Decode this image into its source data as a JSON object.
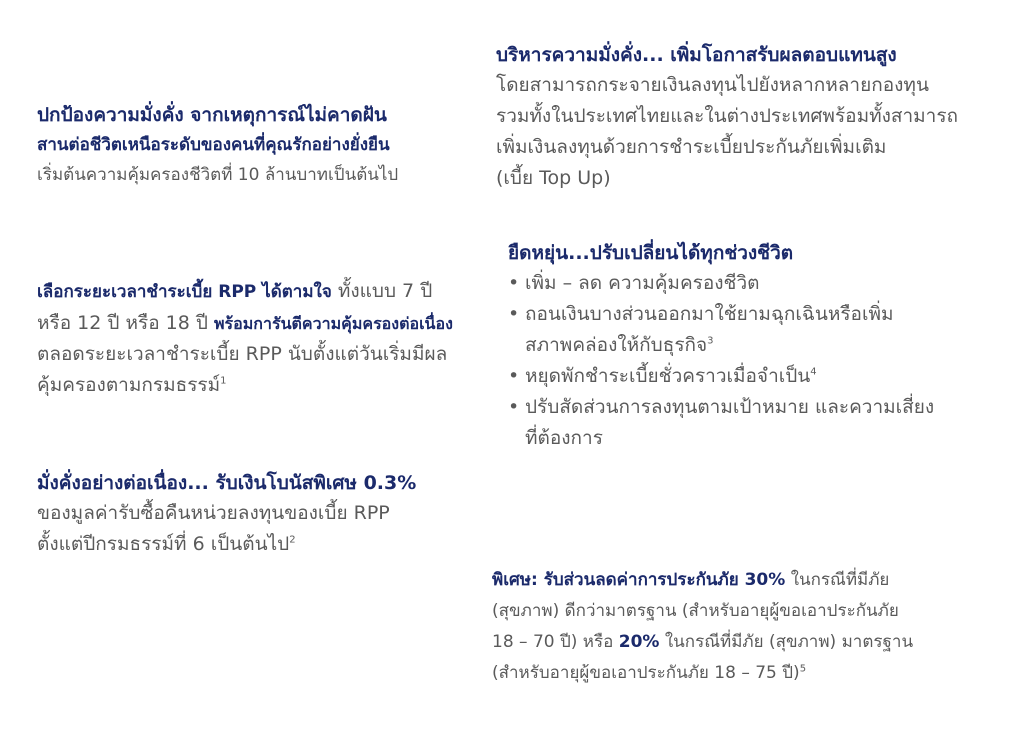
{
  "block1": {
    "title": "ปกป้องความมั่งคั่ง จากเหตุการณ์ไม่คาดฝัน",
    "subtitle": "สานต่อชีวิตเหนือระดับของคนที่คุณรักอย่างยั่งยืน",
    "body": "เริ่มต้นความคุ้มครองชีวิตที่ 10 ล้านบาทเป็นต้นไป"
  },
  "block2": {
    "title": "บริหารความมั่งคั่ง... เพิ่มโอกาสรับผลตอบแทนสูง",
    "lines": [
      "โดยสามารถกระจายเงินลงทุนไปยังหลากหลายกองทุน",
      "รวมทั้งในประเทศไทยและในต่างประเทศพร้อมทั้งสามารถ",
      "เพิ่มเงินลงทุนด้วยการชำระเบี้ยประกันภัยเพิ่มเติม",
      "(เบี้ย Top Up)"
    ]
  },
  "block3": {
    "bold1": "เลือกระยะเวลาชำระเบี้ย RPP ได้ตามใจ",
    "text1": " ทั้งแบบ 7 ปี",
    "text2": "หรือ 12 ปี หรือ 18 ปี ",
    "bold2": "พร้อมการันตีความคุ้มครองต่อเนื่อง",
    "text3": "ตลอดระยะเวลาชำระเบี้ย RPP นับตั้งแต่วันเริ่มมีผล",
    "text4": "คุ้มครองตามกรมธรรม์",
    "fn": "1"
  },
  "block4": {
    "title": "ยืดหยุ่น...ปรับเปลี่ยนได้ทุกช่วงชีวิต",
    "item1": "เพิ่ม – ลด ความคุ้มครองชีวิต",
    "item2a": "ถอนเงินบางส่วนออกมาใช้ยามฉุกเฉินหรือเพิ่ม",
    "item2b": "สภาพคล่องให้กับธุรกิจ",
    "item2fn": "3",
    "item3": "หยุดพักชำระเบี้ยชั่วคราวเมื่อจำเป็น",
    "item3fn": "4",
    "item4a": "ปรับสัดส่วนการลงทุนตามเป้าหมาย และความเสี่ยง",
    "item4b": "ที่ต้องการ"
  },
  "block5": {
    "title": "มั่งคั่งอย่างต่อเนื่อง... รับเงินโบนัสพิเศษ 0.3%",
    "line1": "ของมูลค่ารับซื้อคืนหน่วยลงทุนของเบี้ย RPP",
    "line2": "ตั้งแต่ปีกรมธรรม์ที่ 6 เป็นต้นไป",
    "fn": "2"
  },
  "block6": {
    "bold1": "พิเศษ: รับส่วนลดค่าการประกันภัย 30%",
    "text1": " ในกรณีที่มีภัย",
    "line2": "(สุขภาพ) ดีกว่ามาตรฐาน (สำหรับอายุผู้ขอเอาประกันภัย",
    "text3a": "18 – 70 ปี) หรือ ",
    "bold3": "20%",
    "text3b": " ในกรณีที่มีภัย (สุขภาพ) มาตรฐาน",
    "line4": "(สำหรับอายุผู้ขอเอาประกันภัย 18 – 75 ปี)",
    "fn": "5"
  }
}
